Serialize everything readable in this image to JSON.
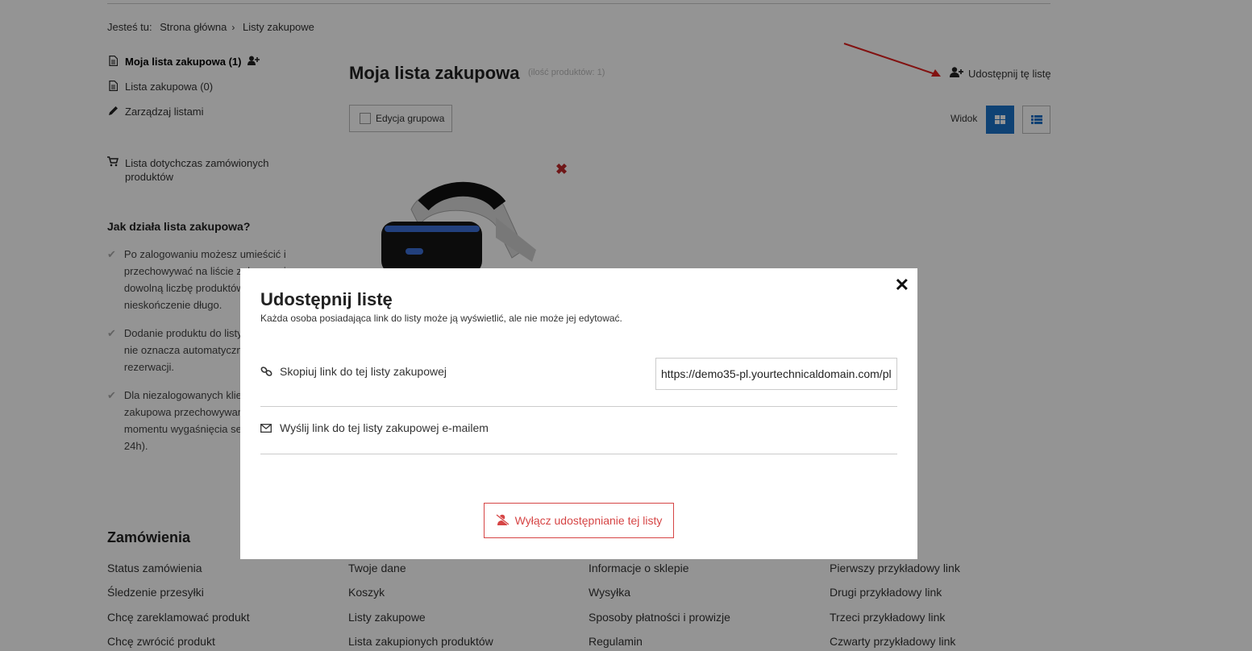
{
  "breadcrumb": {
    "prefix": "Jesteś tu:",
    "home": "Strona główna",
    "separator": "›",
    "current": "Listy zakupowe"
  },
  "sidebar": {
    "items": [
      {
        "label": "Moja lista zakupowa (1)",
        "icon": "document-icon"
      },
      {
        "label": "Lista zakupowa (0)",
        "icon": "document-icon"
      },
      {
        "label": "Zarządzaj listami",
        "icon": "pencil-icon"
      },
      {
        "label_line1": "Lista dotychczas zamówionych",
        "label_line2": "produktów",
        "icon": "cart-icon"
      }
    ],
    "how_title": "Jak działa lista zakupowa?",
    "how_items": [
      {
        "l1": "Po zalogowaniu możesz umieścić i",
        "l2": "przechowywać na liście zakupowej",
        "l3": "dowolną liczbę produktów",
        "l4": "nieskończenie długo."
      },
      {
        "l1": "Dodanie produktu do listy",
        "l2": "nie oznacza automatycznej",
        "l3": "rezerwacji."
      },
      {
        "l1": "Dla niezalogowanych klientów lista",
        "l2": "zakupowa przechowywana jest do",
        "l3": "momentu wygaśnięcia sesji (ok.",
        "l4": "24h)."
      }
    ]
  },
  "main": {
    "title": "Moja lista zakupowa",
    "count": "(ilość produktów: 1)",
    "share_label": "Udostępnij tę listę",
    "group_edit_label": "Edycja grupowa",
    "view_label": "Widok"
  },
  "footer": {
    "title": "Zamówienia",
    "col1": [
      "Status zamówienia",
      "Śledzenie przesyłki",
      "Chcę zareklamować produkt",
      "Chcę zwrócić produkt"
    ],
    "col2": [
      "Twoje dane",
      "Koszyk",
      "Listy zakupowe",
      "Lista zakupionych produktów"
    ],
    "col3": [
      "Informacje o sklepie",
      "Wysyłka",
      "Sposoby płatności i prowizje",
      "Regulamin"
    ],
    "col4": [
      "Pierwszy przykładowy link",
      "Drugi przykładowy link",
      "Trzeci przykładowy link",
      "Czwarty przykładowy link"
    ]
  },
  "modal": {
    "title": "Udostępnij listę",
    "subtitle": "Każda osoba posiadająca link do listy może ją wyświetlić, ale nie może jej edytować.",
    "copy_label": "Skopiuj link do tej listy zakupowej",
    "link_value": "https://demo35-pl.yourtechnicaldomain.com/pl",
    "email_label": "Wyślij link do tej listy zakupowej e-mailem",
    "disable_label": "Wyłącz udostępnianie tej listy",
    "close_symbol": "✕"
  },
  "colors": {
    "accent": "#1a73c8",
    "danger": "#d64545",
    "arrow": "#e0201e"
  }
}
